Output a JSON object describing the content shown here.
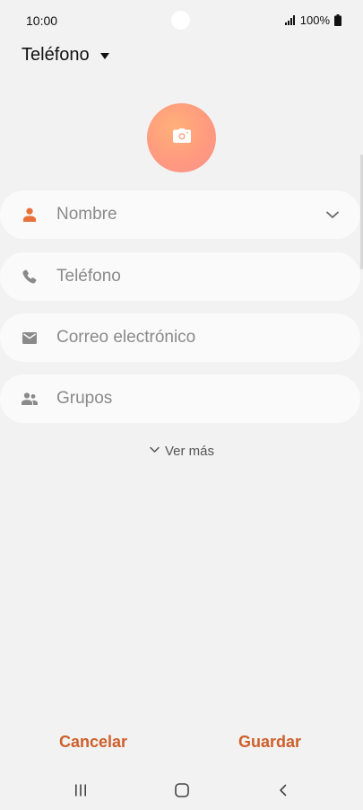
{
  "status_bar": {
    "time": "10:00",
    "battery": "100%",
    "icons": [
      "signal-icon",
      "battery-icon"
    ]
  },
  "header": {
    "storage_label": "Teléfono",
    "caret_icon": "caret-down-icon"
  },
  "photo": {
    "icon": "camera-icon",
    "gradient_colors": [
      "#ffb07a",
      "#f9928c"
    ]
  },
  "fields": {
    "name": {
      "placeholder": "Nombre",
      "icon": "person-icon",
      "icon_color": "#e8713a",
      "expand_icon": "chevron-down-icon"
    },
    "phone": {
      "placeholder": "Teléfono",
      "icon": "phone-icon"
    },
    "email": {
      "placeholder": "Correo electrónico",
      "icon": "mail-icon"
    },
    "groups": {
      "placeholder": "Grupos",
      "icon": "groups-icon"
    }
  },
  "more": {
    "label": "Ver más",
    "icon": "chevron-down-icon"
  },
  "actions": {
    "cancel": "Cancelar",
    "save": "Guardar",
    "color": "#cf5f2b"
  },
  "navigation": [
    "recent-apps-icon",
    "home-icon",
    "back-icon"
  ]
}
